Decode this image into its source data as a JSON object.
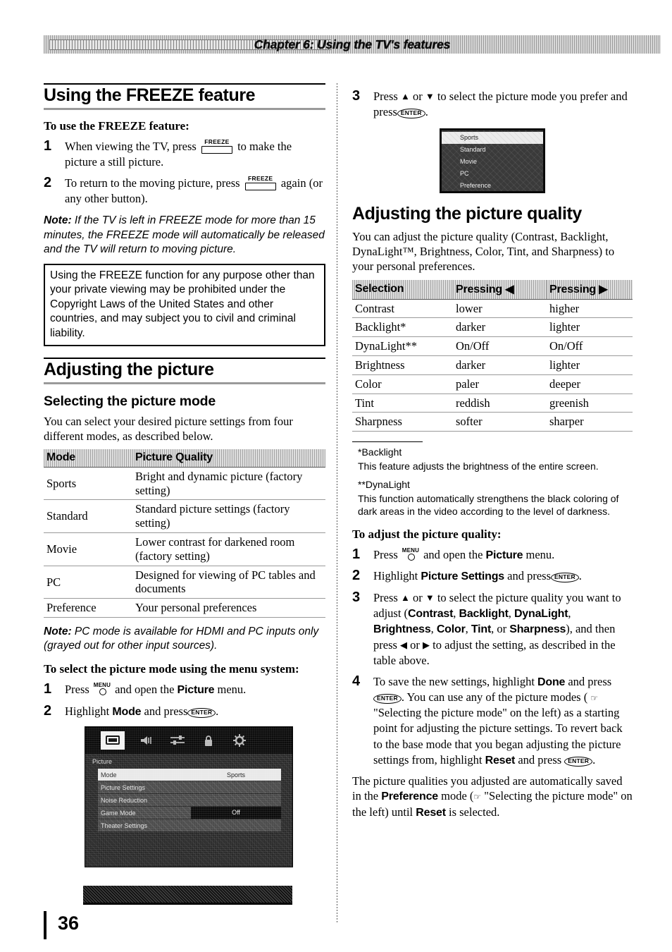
{
  "header": {
    "chapter_title": "Chapter 6: Using the TV's features"
  },
  "footer": {
    "page_number": "36"
  },
  "left_column": {
    "section_heading": "Using the FREEZE feature",
    "procedure_heading": "To use the FREEZE feature:",
    "steps": [
      {
        "num": "1",
        "text_before": "When viewing the TV, press",
        "key": "FREEZE",
        "text_after": "to make the picture a still picture."
      },
      {
        "num": "2",
        "text_before": "To return to the moving picture, press",
        "key": "FREEZE",
        "text_after": "again (or any other button)."
      }
    ],
    "note": {
      "label": "Note:",
      "text": "If the TV is left in FREEZE mode for more than 15 minutes, the FREEZE mode will automatically be released and the TV will return to moving picture."
    },
    "warning_box": {
      "text": "Using the FREEZE function for any purpose other than your private viewing may be prohibited under the Copyright Laws of the United States and other countries, and may subject you to civil and criminal liability."
    },
    "section_heading_2": "Adjusting the picture",
    "subsection_heading": "Selecting the picture mode",
    "intro": "You can select your desired picture settings from four different modes, as described below.",
    "mode_table": {
      "headers": [
        "Mode",
        "Picture Quality"
      ],
      "rows": [
        [
          "Sports",
          "Bright and dynamic picture (factory setting)"
        ],
        [
          "Standard",
          "Standard picture settings (factory setting)"
        ],
        [
          "Movie",
          "Lower contrast for darkened room (factory setting)"
        ],
        [
          "PC",
          "Designed for viewing of PC tables and documents"
        ],
        [
          "Preference",
          "Your personal preferences"
        ]
      ]
    },
    "note_2": {
      "label": "Note:",
      "text": "PC mode is available for HDMI and PC inputs only (grayed out for other input sources)."
    },
    "procedure_heading_2": "To select the picture mode using the menu system:",
    "steps_2": [
      {
        "num": "1",
        "text_before": "Press",
        "key": "MENU",
        "text_mid": "and open the",
        "bold": "Picture",
        "text_after": "menu."
      },
      {
        "num": "2",
        "text_before": "Highlight",
        "bold": "Mode",
        "text_mid": "and press",
        "key": "ENTER",
        "text_after": "."
      }
    ],
    "osd_screenshot": {
      "menu_title": "Picture",
      "icons": [
        "picture-icon",
        "sound-icon",
        "settings-icon",
        "lock-icon",
        "gear-icon"
      ],
      "rows": [
        {
          "label": "Mode",
          "value": "Sports",
          "highlighted": true
        },
        {
          "label": "Picture Settings",
          "value": "",
          "highlighted": false
        },
        {
          "label": "Noise Reduction",
          "value": "",
          "highlighted": false
        },
        {
          "label": "Game Mode",
          "value": "Off",
          "highlighted": false
        },
        {
          "label": "Theater Settings",
          "value": "",
          "highlighted": false
        }
      ]
    }
  },
  "right_column": {
    "step_3": {
      "num": "3",
      "text_before": "Press",
      "arrow_up": "▲",
      "text_or": "or",
      "arrow_down": "▼",
      "text_mid": "to select the picture mode you prefer and press",
      "key": "ENTER",
      "text_after": "."
    },
    "osd_mode_list": {
      "items": [
        {
          "label": "Sports",
          "highlighted": true
        },
        {
          "label": "Standard",
          "highlighted": false
        },
        {
          "label": "Movie",
          "highlighted": false
        },
        {
          "label": "PC",
          "highlighted": false
        },
        {
          "label": "Preference",
          "highlighted": false
        }
      ]
    },
    "section_heading": "Adjusting the picture quality",
    "intro": "You can adjust the picture quality (Contrast, Backlight, DynaLight™, Brightness, Color, Tint, and Sharpness) to your personal preferences.",
    "quality_table": {
      "headers": [
        "Selection",
        "Pressing ◀",
        "Pressing ▶"
      ],
      "rows": [
        [
          "Contrast",
          "lower",
          "higher"
        ],
        [
          "Backlight*",
          "darker",
          "lighter"
        ],
        [
          "DynaLight**",
          "On/Off",
          "On/Off"
        ],
        [
          "Brightness",
          "darker",
          "lighter"
        ],
        [
          "Color",
          "paler",
          "deeper"
        ],
        [
          "Tint",
          "reddish",
          "greenish"
        ],
        [
          "Sharpness",
          "softer",
          "sharper"
        ]
      ]
    },
    "footnotes": [
      {
        "title": "*Backlight",
        "text": "This feature adjusts the brightness of the entire screen."
      },
      {
        "title": "**DynaLight",
        "text": "This function automatically strengthens the black coloring of dark areas in the video according to the level of darkness."
      }
    ],
    "procedure_heading": "To adjust the picture quality:",
    "steps": [
      {
        "num": "1",
        "text_before": "Press",
        "key": "MENU",
        "text_mid": "and open the",
        "bold": "Picture",
        "text_after": "menu."
      },
      {
        "num": "2",
        "text_before": "Highlight",
        "bold": "Picture Settings",
        "text_mid": "and press",
        "key": "ENTER",
        "text_after": "."
      },
      {
        "num": "3",
        "seg1": "Press",
        "arrow_up": "▲",
        "or1": "or",
        "arrow_down": "▼",
        "seg2": "to select the picture quality you want to adjust (",
        "bold_list": [
          "Contrast",
          "Backlight",
          "DynaLight",
          "Brightness",
          "Color",
          "Tint",
          "Sharpness"
        ],
        "seg3": "), and then press",
        "arrow_left": "◀",
        "or2": "or",
        "arrow_right": "▶",
        "seg4": "to adjust the setting, as described in the table above."
      },
      {
        "num": "4",
        "seg1": "To save the new settings, highlight",
        "bold1": "Done",
        "seg2": "and press",
        "key1": "ENTER",
        "seg3": ". You can use any of the picture modes (",
        "ref": "☞",
        "seg4": "\"Selecting the picture mode\" on the left) as a starting point for adjusting the picture settings. To revert back to the base mode that you began adjusting the picture settings from, highlight",
        "bold2": "Reset",
        "seg5": "and press",
        "key2": "ENTER",
        "seg6": "."
      }
    ],
    "closing": {
      "seg1": "The picture qualities you adjusted are automatically saved in the",
      "bold1": "Preference",
      "seg2": "mode (",
      "ref": "☞",
      "seg3": "\"Selecting the picture mode\" on the left) until",
      "bold2": "Reset",
      "seg4": "is selected."
    }
  }
}
